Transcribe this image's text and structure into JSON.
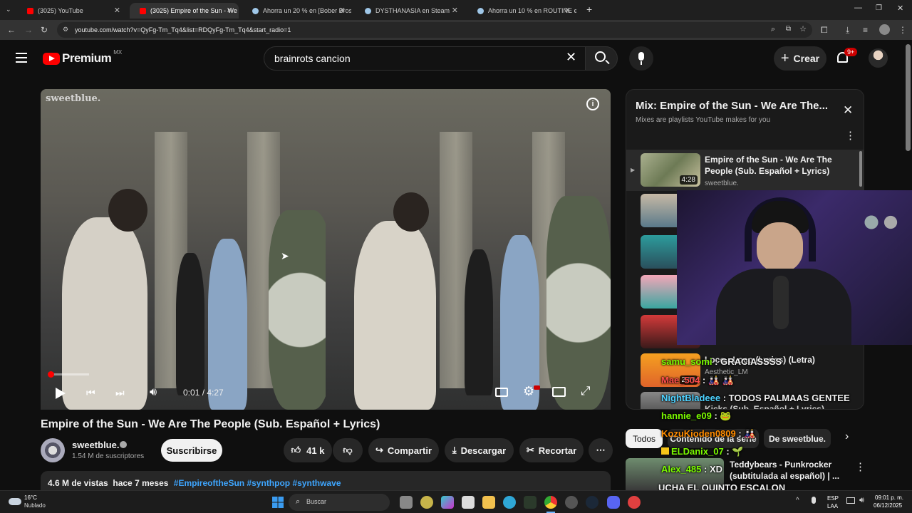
{
  "browser": {
    "tabs": [
      {
        "title": "(3025) YouTube",
        "color": "#ff0000",
        "active": false
      },
      {
        "title": "(3025) Empire of the Sun - We",
        "color": "#ff0000",
        "active": true
      },
      {
        "title": "Ahorra un 20 % en [Bober Bros]",
        "color": "#1b2838",
        "active": false
      },
      {
        "title": "DYSTHANASIA en Steam",
        "color": "#1b2838",
        "active": false
      },
      {
        "title": "Ahorra un 10 % en ROUTINE en",
        "color": "#1b2838",
        "active": false
      }
    ],
    "new_tab": "+",
    "url": "youtube.com/watch?v=QyFg-Tm_Tq4&list=RDQyFg-Tm_Tq4&start_radio=1"
  },
  "header": {
    "logo": "Premium",
    "country": "MX",
    "search_value": "brainrots cancion",
    "create_label": "Crear",
    "notif_count": "9+"
  },
  "video": {
    "watermark": "sweetblue.",
    "time": "0:01 / 4:27",
    "progress": 0.004,
    "title": "Empire of the Sun - We Are The People (Sub. Español + Lyrics)"
  },
  "channel": {
    "name": "sweetblue.",
    "subs": "1.54 M de suscriptores",
    "subscribe": "Suscribirse"
  },
  "actions": {
    "likes": "41 k",
    "share": "Compartir",
    "download": "Descargar",
    "clip": "Recortar"
  },
  "description": {
    "views": "4.6 M de vistas  hace 7 meses",
    "tags": "#EmpireoftheSun #synthpop #synthwave"
  },
  "playlist": {
    "title": "Mix: Empire of the Sun - We Are The...",
    "subtitle": "Mixes are playlists YouTube makes for you",
    "items": [
      {
        "title": "Empire of the Sun - We Are The People (Sub. Español + Lyrics)",
        "channel": "sweetblue.",
        "duration": "4:28"
      },
      {
        "title": "Loco - Loco (Lyrics) (Letra)",
        "channel": "Aesthetic_LM",
        "duration": "2:59"
      },
      {
        "title": "Kicks (Sub. Español + Lyrics)",
        "channel": "",
        "duration": ""
      }
    ]
  },
  "chips": {
    "all": "Todos",
    "related": "Contenido de la serie",
    "from": "De sweetblue."
  },
  "recommended": {
    "title": "Teddybears - Punkrocker (subtitulada al español) | ..."
  },
  "chat": [
    {
      "user": "samu_somi",
      "msg": "GRACIASSSS",
      "color": "#7CFC00"
    },
    {
      "user": "Mae_504",
      "msg": "🎎 🎎",
      "color": "#ff4d4d"
    },
    {
      "user": "NightBladeee",
      "msg": "TODOS PALMAAS GENTEE",
      "color": "#4dd2ff"
    },
    {
      "user": "hannie_e09",
      "msg": "🐸",
      "color": "#7CFC00"
    },
    {
      "user": "KozuKioden0809",
      "msg": "🎎",
      "color": "#ff8c00"
    },
    {
      "user": "ELDanix_07",
      "msg": "🌱",
      "color": "#7CFC00"
    },
    {
      "user": "Alex_485",
      "msg": "XD",
      "color": "#7CFC00"
    },
    {
      "user": "",
      "msg": "UCHA EL QUINTO ESCALON",
      "color": "#ffffff"
    }
  ],
  "taskbar": {
    "weather_temp": "16°C",
    "weather_desc": "Nublado",
    "search": "Buscar",
    "lang1": "ESP",
    "lang2": "LAA",
    "time": "09:01 p. m.",
    "date": "06/12/2025"
  }
}
